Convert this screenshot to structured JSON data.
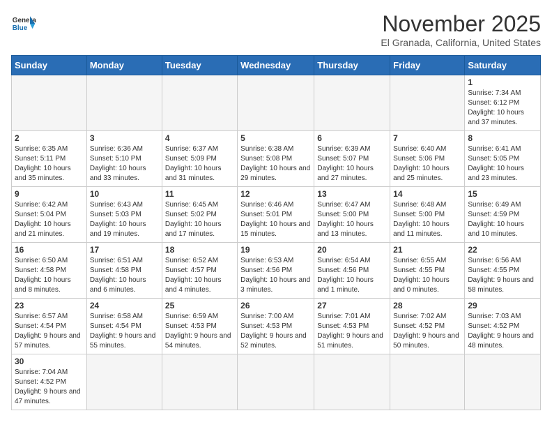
{
  "header": {
    "logo_general": "General",
    "logo_blue": "Blue",
    "title": "November 2025",
    "location": "El Granada, California, United States"
  },
  "days_of_week": [
    "Sunday",
    "Monday",
    "Tuesday",
    "Wednesday",
    "Thursday",
    "Friday",
    "Saturday"
  ],
  "weeks": [
    [
      {
        "day": null,
        "info": null
      },
      {
        "day": null,
        "info": null
      },
      {
        "day": null,
        "info": null
      },
      {
        "day": null,
        "info": null
      },
      {
        "day": null,
        "info": null
      },
      {
        "day": null,
        "info": null
      },
      {
        "day": "1",
        "info": "Sunrise: 7:34 AM\nSunset: 6:12 PM\nDaylight: 10 hours and 37 minutes."
      }
    ],
    [
      {
        "day": "2",
        "info": "Sunrise: 6:35 AM\nSunset: 5:11 PM\nDaylight: 10 hours and 35 minutes."
      },
      {
        "day": "3",
        "info": "Sunrise: 6:36 AM\nSunset: 5:10 PM\nDaylight: 10 hours and 33 minutes."
      },
      {
        "day": "4",
        "info": "Sunrise: 6:37 AM\nSunset: 5:09 PM\nDaylight: 10 hours and 31 minutes."
      },
      {
        "day": "5",
        "info": "Sunrise: 6:38 AM\nSunset: 5:08 PM\nDaylight: 10 hours and 29 minutes."
      },
      {
        "day": "6",
        "info": "Sunrise: 6:39 AM\nSunset: 5:07 PM\nDaylight: 10 hours and 27 minutes."
      },
      {
        "day": "7",
        "info": "Sunrise: 6:40 AM\nSunset: 5:06 PM\nDaylight: 10 hours and 25 minutes."
      },
      {
        "day": "8",
        "info": "Sunrise: 6:41 AM\nSunset: 5:05 PM\nDaylight: 10 hours and 23 minutes."
      }
    ],
    [
      {
        "day": "9",
        "info": "Sunrise: 6:42 AM\nSunset: 5:04 PM\nDaylight: 10 hours and 21 minutes."
      },
      {
        "day": "10",
        "info": "Sunrise: 6:43 AM\nSunset: 5:03 PM\nDaylight: 10 hours and 19 minutes."
      },
      {
        "day": "11",
        "info": "Sunrise: 6:45 AM\nSunset: 5:02 PM\nDaylight: 10 hours and 17 minutes."
      },
      {
        "day": "12",
        "info": "Sunrise: 6:46 AM\nSunset: 5:01 PM\nDaylight: 10 hours and 15 minutes."
      },
      {
        "day": "13",
        "info": "Sunrise: 6:47 AM\nSunset: 5:00 PM\nDaylight: 10 hours and 13 minutes."
      },
      {
        "day": "14",
        "info": "Sunrise: 6:48 AM\nSunset: 5:00 PM\nDaylight: 10 hours and 11 minutes."
      },
      {
        "day": "15",
        "info": "Sunrise: 6:49 AM\nSunset: 4:59 PM\nDaylight: 10 hours and 10 minutes."
      }
    ],
    [
      {
        "day": "16",
        "info": "Sunrise: 6:50 AM\nSunset: 4:58 PM\nDaylight: 10 hours and 8 minutes."
      },
      {
        "day": "17",
        "info": "Sunrise: 6:51 AM\nSunset: 4:58 PM\nDaylight: 10 hours and 6 minutes."
      },
      {
        "day": "18",
        "info": "Sunrise: 6:52 AM\nSunset: 4:57 PM\nDaylight: 10 hours and 4 minutes."
      },
      {
        "day": "19",
        "info": "Sunrise: 6:53 AM\nSunset: 4:56 PM\nDaylight: 10 hours and 3 minutes."
      },
      {
        "day": "20",
        "info": "Sunrise: 6:54 AM\nSunset: 4:56 PM\nDaylight: 10 hours and 1 minute."
      },
      {
        "day": "21",
        "info": "Sunrise: 6:55 AM\nSunset: 4:55 PM\nDaylight: 10 hours and 0 minutes."
      },
      {
        "day": "22",
        "info": "Sunrise: 6:56 AM\nSunset: 4:55 PM\nDaylight: 9 hours and 58 minutes."
      }
    ],
    [
      {
        "day": "23",
        "info": "Sunrise: 6:57 AM\nSunset: 4:54 PM\nDaylight: 9 hours and 57 minutes."
      },
      {
        "day": "24",
        "info": "Sunrise: 6:58 AM\nSunset: 4:54 PM\nDaylight: 9 hours and 55 minutes."
      },
      {
        "day": "25",
        "info": "Sunrise: 6:59 AM\nSunset: 4:53 PM\nDaylight: 9 hours and 54 minutes."
      },
      {
        "day": "26",
        "info": "Sunrise: 7:00 AM\nSunset: 4:53 PM\nDaylight: 9 hours and 52 minutes."
      },
      {
        "day": "27",
        "info": "Sunrise: 7:01 AM\nSunset: 4:53 PM\nDaylight: 9 hours and 51 minutes."
      },
      {
        "day": "28",
        "info": "Sunrise: 7:02 AM\nSunset: 4:52 PM\nDaylight: 9 hours and 50 minutes."
      },
      {
        "day": "29",
        "info": "Sunrise: 7:03 AM\nSunset: 4:52 PM\nDaylight: 9 hours and 48 minutes."
      }
    ],
    [
      {
        "day": "30",
        "info": "Sunrise: 7:04 AM\nSunset: 4:52 PM\nDaylight: 9 hours and 47 minutes."
      },
      {
        "day": null,
        "info": null
      },
      {
        "day": null,
        "info": null
      },
      {
        "day": null,
        "info": null
      },
      {
        "day": null,
        "info": null
      },
      {
        "day": null,
        "info": null
      },
      {
        "day": null,
        "info": null
      }
    ]
  ]
}
